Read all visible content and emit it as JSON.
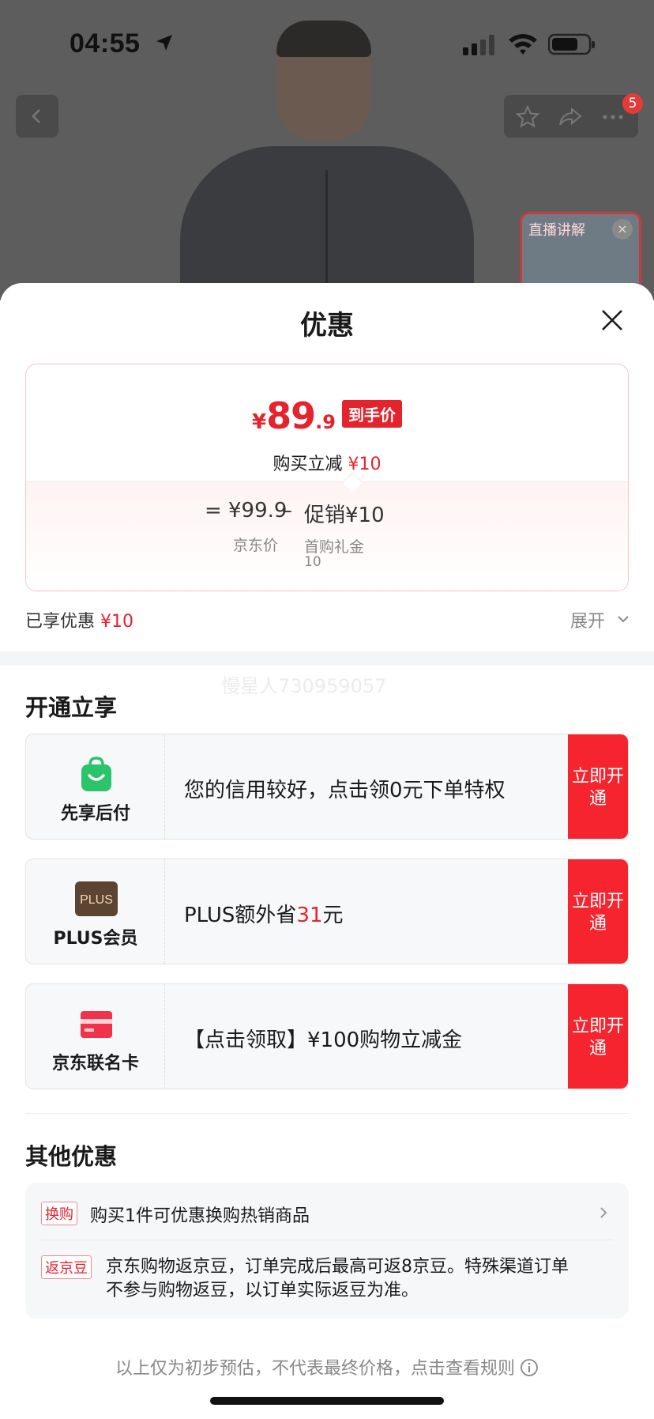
{
  "status_bar": {
    "time": "04:55"
  },
  "header": {
    "cart_badge": "5",
    "live_label": "直播讲解",
    "live_close": "×"
  },
  "sheet": {
    "title": "优惠",
    "price": {
      "currency": "¥",
      "integer": "89",
      "decimal": ".9",
      "tag": "到手价",
      "reduce_label": "购买立减",
      "reduce_amount": "¥10",
      "formula": {
        "equals": "=",
        "jd_price": "¥99.9",
        "jd_price_label": "京东价",
        "minus": "–",
        "promo": "促销¥10",
        "promo_label": "首购礼金",
        "promo_value": "10"
      }
    },
    "enjoyed_label": "已享优惠",
    "enjoyed_amount": "¥10",
    "expand_label": "展开",
    "watermark": "慢星人730959057",
    "open_section_title": "开通立享",
    "benefits": [
      {
        "name": "先享后付",
        "desc": "您的信用较好，点击领0元下单特权",
        "button": "立即开通"
      },
      {
        "name": "PLUS会员",
        "desc_prefix": "PLUS额外省",
        "desc_highlight": "31",
        "desc_suffix": "元",
        "button": "立即开通",
        "icon_text": "PLUS"
      },
      {
        "name": "京东联名卡",
        "desc": "【点击领取】¥100购物立减金",
        "button": "立即开通"
      }
    ],
    "other_section_title": "其他优惠",
    "others": [
      {
        "tag": "换购",
        "text": "购买1件可优惠换购热销商品"
      },
      {
        "tag": "返京豆",
        "line1": "京东购物返京豆，订单完成后最高可返8京豆。特殊渠道订单",
        "line2": "不参与购物返豆，以订单实际返豆为准。"
      }
    ],
    "footer": "以上仅为初步预估，不代表最终价格，点击查看规则"
  },
  "colors": {
    "accent": "#e4232d",
    "button_red": "#f5242e",
    "jd_green": "#2bc46b"
  },
  "icons": [
    "location-arrow-icon",
    "signal-icon",
    "wifi-icon",
    "battery-icon",
    "back-icon",
    "star-icon",
    "share-icon",
    "more-icon",
    "close-icon",
    "chevron-down-icon",
    "bag-icon",
    "plus-logo-icon",
    "card-icon",
    "chevron-right-icon",
    "info-icon"
  ]
}
